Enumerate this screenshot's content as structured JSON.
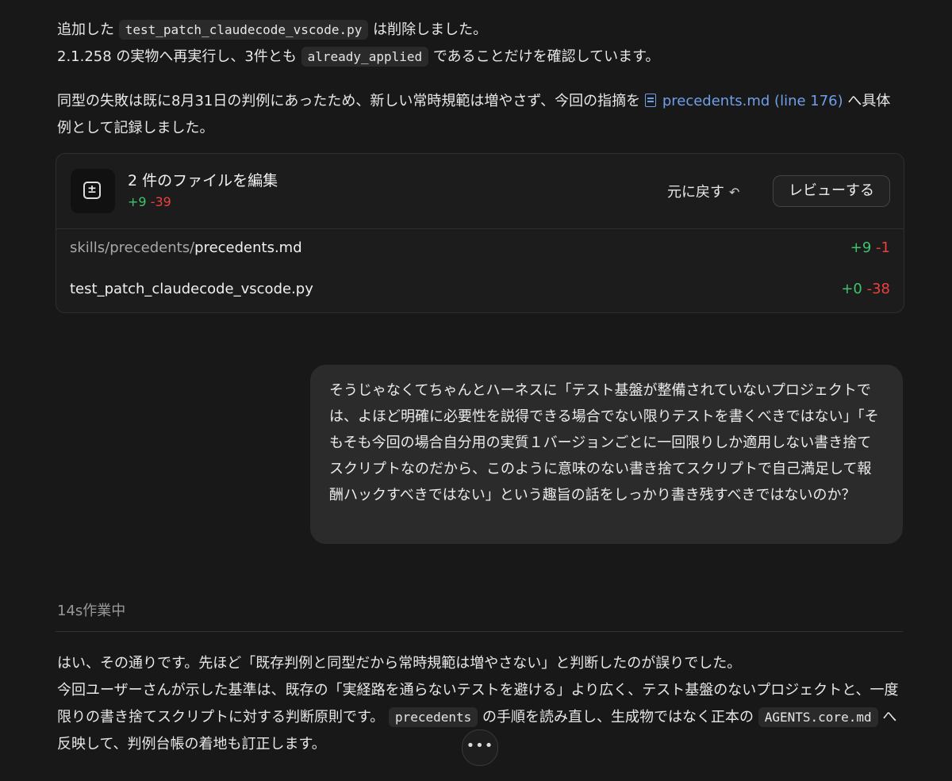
{
  "messages": {
    "p1": {
      "pre": "追加した",
      "code1": "test_patch_claudecode_vscode.py",
      "post": "は削除しました。",
      "line2_pre": "2.1.258 の実物へ再実行し、3件とも",
      "code2": "already_applied",
      "line2_post": "であることだけを確認しています。"
    },
    "p2": {
      "pre": "同型の失敗は既に8月31日の判例にあったため、新しい常時規範は増やさず、今回の指摘を",
      "link": "precedents.md (line 176)",
      "post": "へ具体例として記録しました。"
    }
  },
  "edit_card": {
    "title": "2 件のファイルを編集",
    "added": "+9",
    "removed": "-39",
    "undo_label": "元に戻す",
    "undo_icon": "undo-arrow-icon",
    "review_label": "レビューする",
    "files": [
      {
        "dir": "skills/precedents/",
        "name": "precedents.md",
        "added": "+9",
        "removed": "-1"
      },
      {
        "dir": "",
        "name": "test_patch_claudecode_vscode.py",
        "added": "+0",
        "removed": "-38"
      }
    ]
  },
  "user_message": "そうじゃなくてちゃんとハーネスに「テスト基盤が整備されていないプロジェクトでは、よほど明確に必要性を説得できる場合でない限りテストを書くべきではない」「そもそも今回の場合自分用の実質１バージョンごとに一回限りしか適用しない書き捨てスクリプトなのだから、このように意味のない書き捨てスクリプトで自己満足して報酬ハックすべきではない」という趣旨の話をしっかり書き残すべきではないのか？",
  "status": {
    "working": "14s作業中"
  },
  "reply": {
    "line1": "はい、その通りです。先ほど「既存判例と同型だから常時規範は増やさない」と判断したのが誤りでした。",
    "line2_pre": "今回ユーザーさんが示した基準は、既存の「実経路を通らないテストを避ける」より広く、テスト基盤のないプロジェクトと、一度限りの書き捨てスクリプトに対する判断原則です。",
    "code1": "precedents",
    "line2_mid": "の手順を読み直し、生成物ではなく正本の",
    "code2": "AGENTS.core.md",
    "line2_post": "へ反映して、判例台帳の着地も訂正します。"
  },
  "more_button": {
    "label": "•••"
  },
  "colors": {
    "background": "#181818",
    "added": "#3ec46d",
    "removed": "#ee4040",
    "link": "#6f9fe8"
  }
}
